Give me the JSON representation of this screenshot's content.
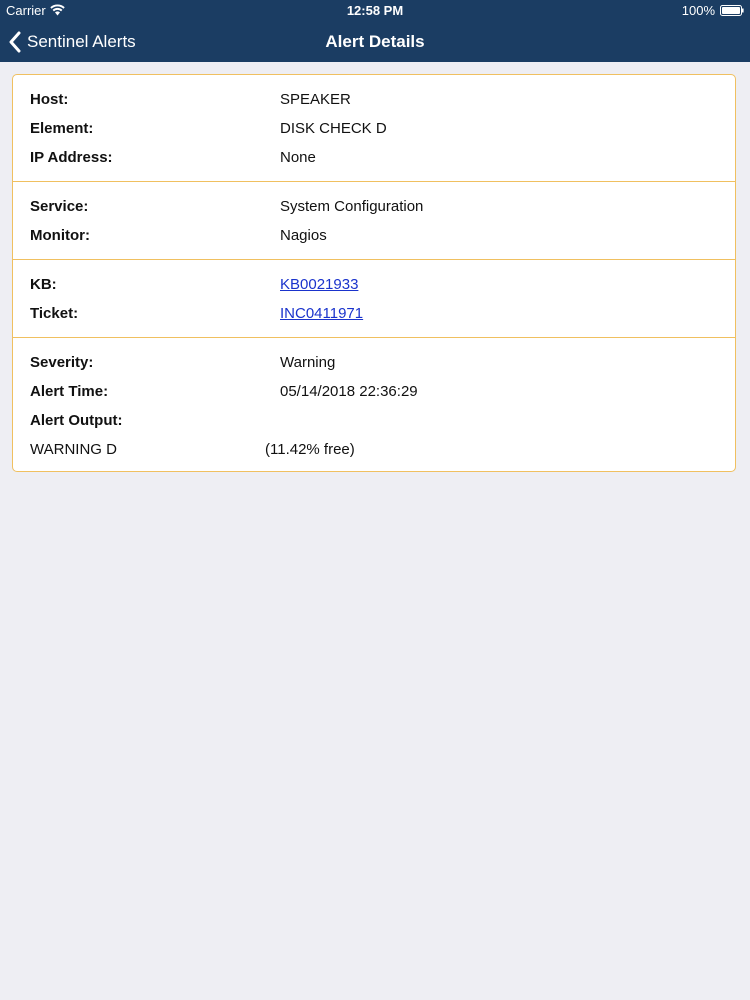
{
  "status_bar": {
    "carrier": "Carrier",
    "time": "12:58 PM",
    "battery": "100%"
  },
  "nav": {
    "back_label": "Sentinel Alerts",
    "title": "Alert Details"
  },
  "colors": {
    "nav_background": "#1b3d63",
    "card_border": "#f0c060",
    "link": "#1a33cc",
    "page_background": "#eeeef3"
  },
  "details": {
    "host": {
      "label": "Host:",
      "value": "SPEAKER"
    },
    "element": {
      "label": "Element:",
      "value": "DISK CHECK D"
    },
    "ip": {
      "label": "IP Address:",
      "value": "None"
    },
    "service": {
      "label": "Service:",
      "value": "System Configuration"
    },
    "monitor": {
      "label": "Monitor:",
      "value": "Nagios"
    },
    "kb": {
      "label": "KB:",
      "value": "KB0021933"
    },
    "ticket": {
      "label": "Ticket:",
      "value": "INC0411971"
    },
    "severity": {
      "label": "Severity:",
      "value": "Warning"
    },
    "alert_time": {
      "label": "Alert Time:",
      "value": "05/14/2018 22:36:29"
    },
    "alert_output": {
      "label": "Alert Output:",
      "text_left": "WARNING D",
      "text_right": "(11.42% free)"
    }
  },
  "icons": {
    "back": "chevron-left-icon",
    "wifi": "wifi-icon",
    "battery": "battery-icon"
  }
}
